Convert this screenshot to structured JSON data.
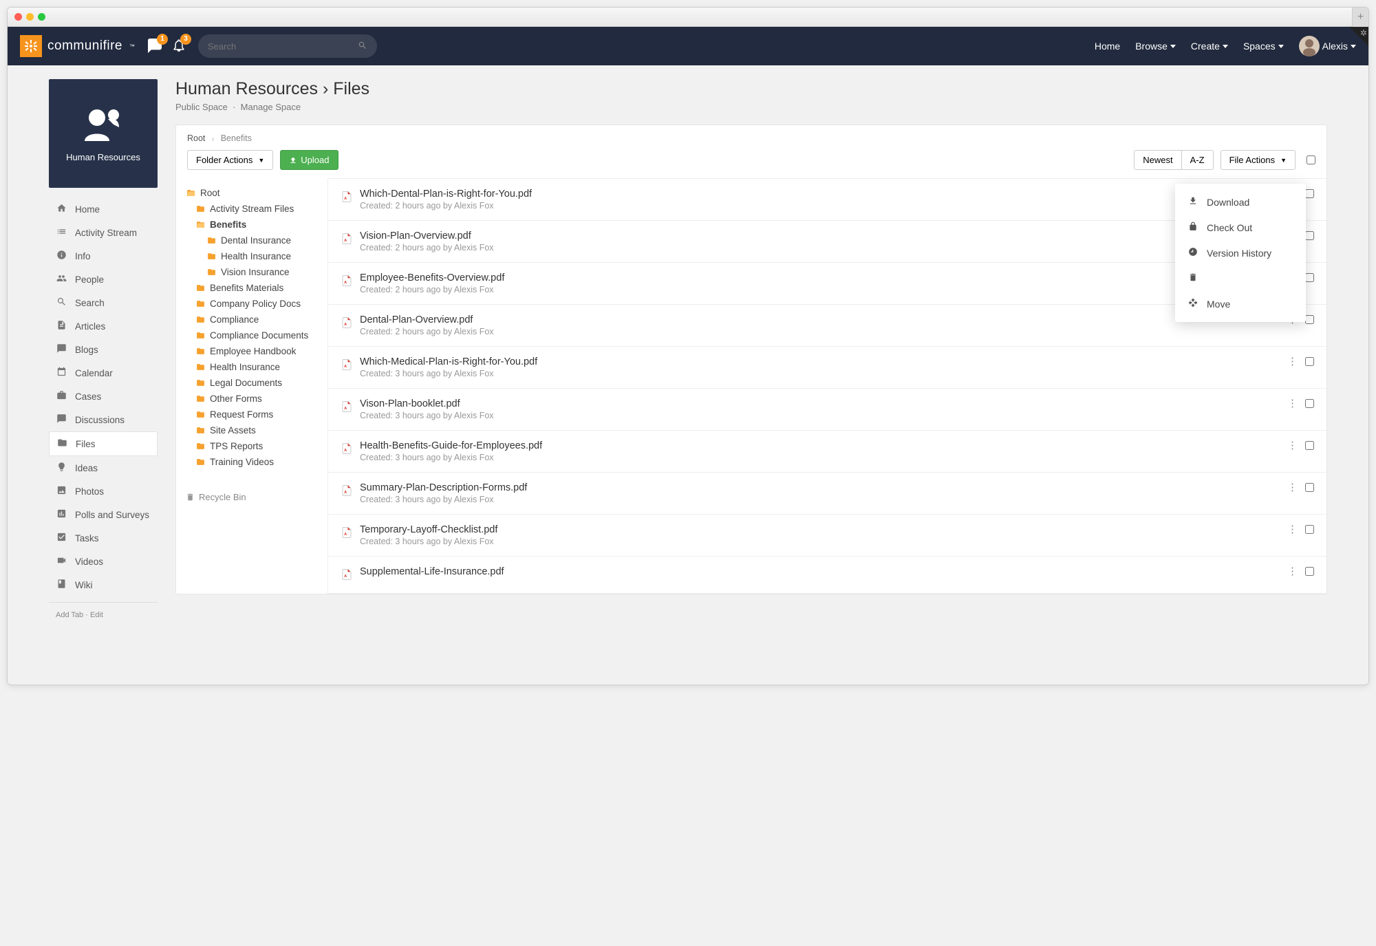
{
  "brand": {
    "name": "communifire",
    "tm": "™"
  },
  "badges": {
    "messages": "1",
    "notifications": "3"
  },
  "search": {
    "placeholder": "Search"
  },
  "nav": {
    "home": "Home",
    "browse": "Browse",
    "create": "Create",
    "spaces": "Spaces",
    "user": "Alexis"
  },
  "space": {
    "title": "Human Resources"
  },
  "sidemenu": {
    "items": [
      {
        "icon": "home",
        "label": "Home",
        "active": false
      },
      {
        "icon": "stream",
        "label": "Activity Stream",
        "active": false
      },
      {
        "icon": "info",
        "label": "Info",
        "active": false
      },
      {
        "icon": "people",
        "label": "People",
        "active": false
      },
      {
        "icon": "search",
        "label": "Search",
        "active": false
      },
      {
        "icon": "article",
        "label": "Articles",
        "active": false
      },
      {
        "icon": "blog",
        "label": "Blogs",
        "active": false
      },
      {
        "icon": "calendar",
        "label": "Calendar",
        "active": false
      },
      {
        "icon": "case",
        "label": "Cases",
        "active": false
      },
      {
        "icon": "discuss",
        "label": "Discussions",
        "active": false
      },
      {
        "icon": "files",
        "label": "Files",
        "active": true
      },
      {
        "icon": "idea",
        "label": "Ideas",
        "active": false
      },
      {
        "icon": "photo",
        "label": "Photos",
        "active": false
      },
      {
        "icon": "poll",
        "label": "Polls and Surveys",
        "active": false
      },
      {
        "icon": "task",
        "label": "Tasks",
        "active": false
      },
      {
        "icon": "video",
        "label": "Videos",
        "active": false
      },
      {
        "icon": "wiki",
        "label": "Wiki",
        "active": false
      }
    ],
    "addTab": "Add Tab",
    "edit": "Edit"
  },
  "header": {
    "title_space": "Human Resources",
    "title_section": "Files",
    "sub_public": "Public Space",
    "sub_manage": "Manage Space"
  },
  "breadcrumb": {
    "root": "Root",
    "current": "Benefits"
  },
  "toolbar": {
    "folderActions": "Folder Actions",
    "upload": "Upload",
    "newest": "Newest",
    "az": "A-Z",
    "fileActions": "File Actions"
  },
  "tree": {
    "root": "Root",
    "nodes": [
      {
        "label": "Activity Stream Files",
        "depth": 1
      },
      {
        "label": "Benefits",
        "depth": 1,
        "open": true,
        "bold": true
      },
      {
        "label": "Dental Insurance",
        "depth": 2
      },
      {
        "label": "Health Insurance",
        "depth": 2
      },
      {
        "label": "Vision Insurance",
        "depth": 2
      },
      {
        "label": "Benefits Materials",
        "depth": 1
      },
      {
        "label": "Company Policy Docs",
        "depth": 1
      },
      {
        "label": "Compliance",
        "depth": 1
      },
      {
        "label": "Compliance Documents",
        "depth": 1
      },
      {
        "label": "Employee Handbook",
        "depth": 1
      },
      {
        "label": "Health Insurance",
        "depth": 1
      },
      {
        "label": "Legal Documents",
        "depth": 1
      },
      {
        "label": "Other Forms",
        "depth": 1
      },
      {
        "label": "Request Forms",
        "depth": 1
      },
      {
        "label": "Site Assets",
        "depth": 1
      },
      {
        "label": "TPS Reports",
        "depth": 1
      },
      {
        "label": "Training Videos",
        "depth": 1
      }
    ],
    "recycle": "Recycle Bin"
  },
  "files": [
    {
      "name": "Which-Dental-Plan-is-Right-for-You.pdf",
      "meta": "Created: 2 hours ago by Alexis Fox"
    },
    {
      "name": "Vision-Plan-Overview.pdf",
      "meta": "Created: 2 hours ago by Alexis Fox"
    },
    {
      "name": "Employee-Benefits-Overview.pdf",
      "meta": "Created: 2 hours ago by Alexis Fox"
    },
    {
      "name": "Dental-Plan-Overview.pdf",
      "meta": "Created: 2 hours ago by Alexis Fox"
    },
    {
      "name": "Which-Medical-Plan-is-Right-for-You.pdf",
      "meta": "Created: 3 hours ago by Alexis Fox"
    },
    {
      "name": "Vison-Plan-booklet.pdf",
      "meta": "Created: 3 hours ago by Alexis Fox"
    },
    {
      "name": "Health-Benefits-Guide-for-Employees.pdf",
      "meta": "Created: 3 hours ago by Alexis Fox"
    },
    {
      "name": "Summary-Plan-Description-Forms.pdf",
      "meta": "Created: 3 hours ago by Alexis Fox"
    },
    {
      "name": "Temporary-Layoff-Checklist.pdf",
      "meta": "Created: 3 hours ago by Alexis Fox"
    },
    {
      "name": "Supplemental-Life-Insurance.pdf",
      "meta": ""
    }
  ],
  "contextMenu": {
    "download": "Download",
    "checkout": "Check Out",
    "history": "Version History",
    "delete": "Delete",
    "move": "Move"
  }
}
